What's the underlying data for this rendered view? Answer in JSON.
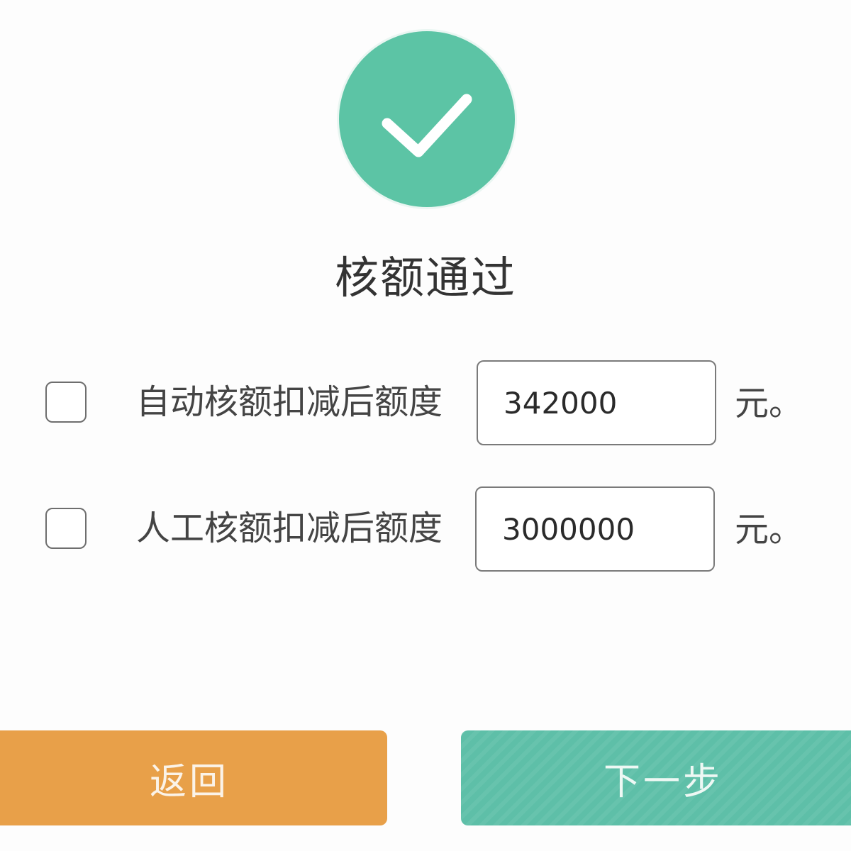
{
  "status": {
    "icon": "check-icon",
    "title": "核额通过",
    "accent_color": "#5cc4a5"
  },
  "rows": [
    {
      "label": "自动核额扣减后额度",
      "value": "342000",
      "unit": "元。",
      "checked": false
    },
    {
      "label": "人工核额扣减后额度",
      "value": "3000000",
      "unit": "元。",
      "checked": false
    }
  ],
  "buttons": {
    "back_label": "返回",
    "back_color": "#e8a049",
    "next_label": "下一步",
    "next_color": "#5ebfa8"
  }
}
